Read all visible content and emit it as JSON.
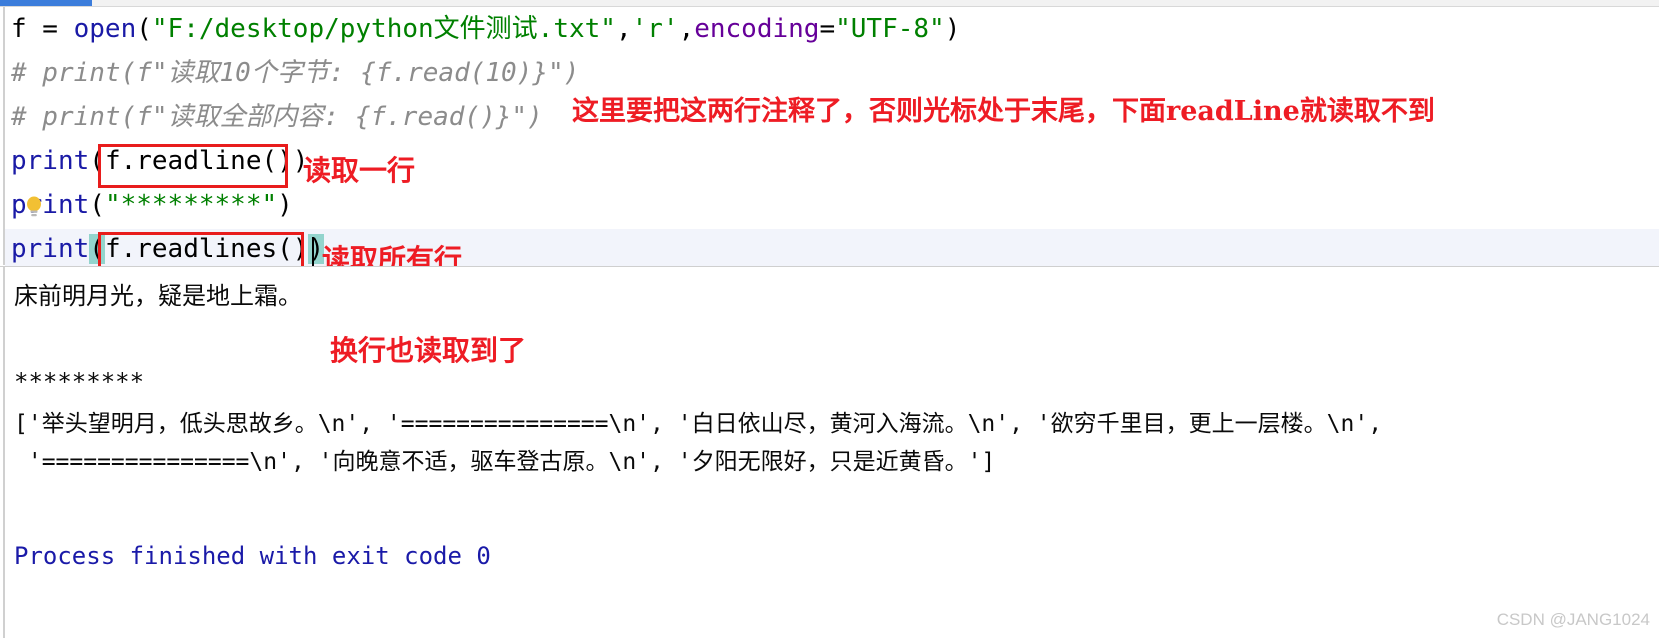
{
  "window": {
    "active_tab_accent": "#3c7ddb"
  },
  "editor": {
    "lines": [
      {
        "id": "line-open",
        "segments": [
          {
            "text": "f = ",
            "cls": "tok-punct"
          },
          {
            "text": "open",
            "cls": "tok-fn"
          },
          {
            "text": "(",
            "cls": "tok-punct"
          },
          {
            "text": "\"F:/desktop/python文件测试.txt\"",
            "cls": "tok-str"
          },
          {
            "text": ",",
            "cls": "tok-punct"
          },
          {
            "text": "'r'",
            "cls": "tok-str"
          },
          {
            "text": ",",
            "cls": "tok-punct"
          },
          {
            "text": "encoding",
            "cls": "tok-named"
          },
          {
            "text": "=",
            "cls": "tok-punct"
          },
          {
            "text": "\"UTF-8\"",
            "cls": "tok-str"
          },
          {
            "text": ")",
            "cls": "tok-punct"
          }
        ]
      },
      {
        "id": "line-comment-1",
        "segments": [
          {
            "text": "# print(f\"读取10个字节: {f.read(10)}\")",
            "cls": "tok-comment"
          }
        ]
      },
      {
        "id": "line-comment-2",
        "segments": [
          {
            "text": "# print(f\"读取全部内容: {f.read()}\")",
            "cls": "tok-comment"
          }
        ]
      },
      {
        "id": "line-readline",
        "segments": [
          {
            "text": "print",
            "cls": "tok-fn"
          },
          {
            "text": "(",
            "cls": "tok-punct"
          },
          {
            "text": "f.readline()",
            "cls": "tok-punct"
          },
          {
            "text": ")",
            "cls": "tok-punct"
          }
        ]
      },
      {
        "id": "line-stars",
        "segments": [
          {
            "text": "print",
            "cls": "tok-fn"
          },
          {
            "text": "(",
            "cls": "tok-punct"
          },
          {
            "text": "\"*********\"",
            "cls": "tok-str"
          },
          {
            "text": ")",
            "cls": "tok-punct"
          }
        ]
      },
      {
        "id": "line-readlines",
        "segments": [
          {
            "text": "print",
            "cls": "tok-fn"
          },
          {
            "text": "(",
            "cls": "tok-punct tok-paren-hl"
          },
          {
            "text": "f.readlines()",
            "cls": "tok-punct"
          },
          {
            "text": ")",
            "cls": "tok-punct tok-paren-hl"
          }
        ]
      }
    ]
  },
  "annotations": {
    "top_note": "这里要把这两行注释了，否则光标处于末尾，下面readLine就读取不到",
    "readline_note": "读取一行",
    "readlines_note": "读取所有行",
    "newline_note": "换行也读取到了",
    "color": "#ee1c24"
  },
  "console": {
    "lines": [
      {
        "id": "console-poem",
        "text": "床前明月光，疑是地上霜。",
        "blue": false
      },
      {
        "id": "console-blank-1",
        "text": "",
        "blue": false
      },
      {
        "id": "console-stars",
        "text": "*********",
        "blue": false
      },
      {
        "id": "console-list-1",
        "text": "['举头望明月，低头思故乡。\\n', '===============\\n', '白日依山尽，黄河入海流。\\n', '欲穷千里目，更上一层楼。\\n',",
        "blue": false
      },
      {
        "id": "console-list-2",
        "text": " '===============\\n', '向晚意不适，驱车登古原。\\n', '夕阳无限好，只是近黄昏。']",
        "blue": false
      },
      {
        "id": "console-exit",
        "text": "Process finished with exit code 0",
        "blue": true
      }
    ]
  },
  "watermark": {
    "text": "CSDN @JANG1024"
  }
}
